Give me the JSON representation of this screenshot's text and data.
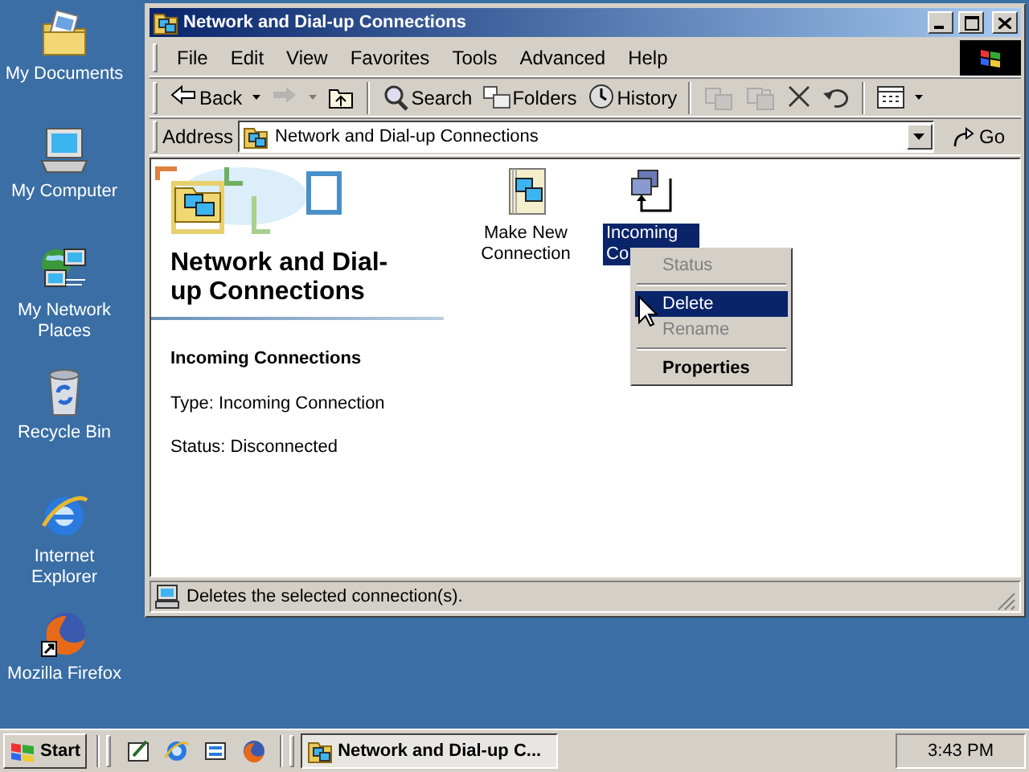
{
  "desktop_icons": [
    {
      "kind": "documents",
      "label": "My Documents"
    },
    {
      "kind": "computer",
      "label": "My Computer"
    },
    {
      "kind": "network",
      "label": "My Network Places"
    },
    {
      "kind": "recycle",
      "label": "Recycle Bin"
    },
    {
      "kind": "ie",
      "label": "Internet Explorer"
    },
    {
      "kind": "firefox",
      "label": "Mozilla Firefox"
    }
  ],
  "window": {
    "title": "Network and Dial-up Connections",
    "menu": [
      "File",
      "Edit",
      "View",
      "Favorites",
      "Tools",
      "Advanced",
      "Help"
    ],
    "toolbar": [
      {
        "kind": "back",
        "label": "Back",
        "disabled": false
      },
      {
        "kind": "forward",
        "disabled": true
      },
      {
        "kind": "up",
        "disabled": false
      },
      {
        "kind": "separator"
      },
      {
        "kind": "search",
        "label": "Search",
        "disabled": false
      },
      {
        "kind": "folders",
        "label": "Folders",
        "disabled": false
      },
      {
        "kind": "history",
        "label": "History",
        "disabled": false
      },
      {
        "kind": "separator"
      },
      {
        "kind": "moveto",
        "disabled": true
      },
      {
        "kind": "copyto",
        "disabled": true
      },
      {
        "kind": "delete",
        "disabled": false
      },
      {
        "kind": "undo",
        "disabled": false
      },
      {
        "kind": "separator"
      },
      {
        "kind": "views",
        "disabled": false
      }
    ],
    "address": {
      "label": "Address",
      "value": "Network and Dial-up Connections",
      "go": "Go"
    },
    "info_pane": {
      "heading": "Network and Dial-up Connections",
      "name": "Incoming Connections",
      "type": "Type: Incoming Connection",
      "status": "Status: Disconnected"
    },
    "items": [
      {
        "kind": "new",
        "label": "Make New Connection",
        "selected": false
      },
      {
        "kind": "incoming",
        "label": "Incoming Co",
        "selected": true
      }
    ],
    "context_menu": [
      {
        "kind": "item",
        "label": "Status",
        "disabled": true,
        "selected": false,
        "default": false
      },
      {
        "kind": "separator"
      },
      {
        "kind": "item",
        "label": "Delete",
        "disabled": false,
        "selected": true,
        "default": false
      },
      {
        "kind": "item",
        "label": "Rename",
        "disabled": true,
        "selected": false,
        "default": false
      },
      {
        "kind": "separator"
      },
      {
        "kind": "item",
        "label": "Properties",
        "disabled": false,
        "selected": false,
        "default": true
      }
    ],
    "status_bar": "Deletes the selected connection(s)."
  },
  "taskbar": {
    "start": "Start",
    "tasks": [
      {
        "label": "Network and Dial-up C...",
        "selected": true
      }
    ],
    "clock": "3:43 PM"
  }
}
